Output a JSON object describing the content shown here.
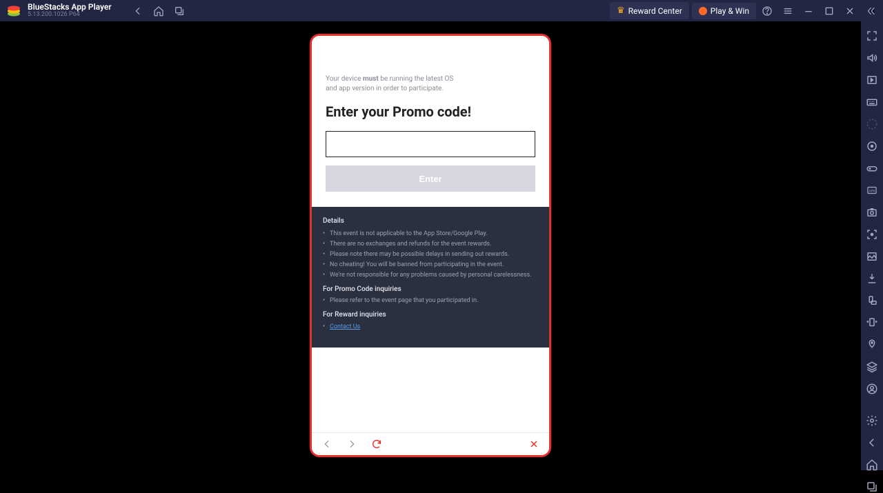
{
  "titlebar": {
    "app_title": "BlueStacks App Player",
    "version": "5.13.200.1026  P64",
    "reward_label": "Reward Center",
    "play_label": "Play & Win"
  },
  "promo": {
    "note_pre": "Your device ",
    "note_bold": "must",
    "note_post": " be running the latest OS",
    "note_line2": "and app version in order to participate.",
    "heading": "Enter your Promo code!",
    "input_value": "",
    "enter_label": "Enter"
  },
  "details": {
    "heading": "Details",
    "items": [
      "This event is not applicable to the App Store/Google Play.",
      "There are no exchanges and refunds for the event rewards.",
      "Please note there may be possible delays in sending out rewards.",
      "No cheating! You will be banned from participating in the event.",
      "We're not responsible for any problems caused by personal carelessness."
    ],
    "promo_heading": "For Promo Code inquiries",
    "promo_items": [
      "Please refer to the event page that you participated in."
    ],
    "reward_heading": "For Reward inquiries",
    "contact_label": "Contact Us"
  }
}
